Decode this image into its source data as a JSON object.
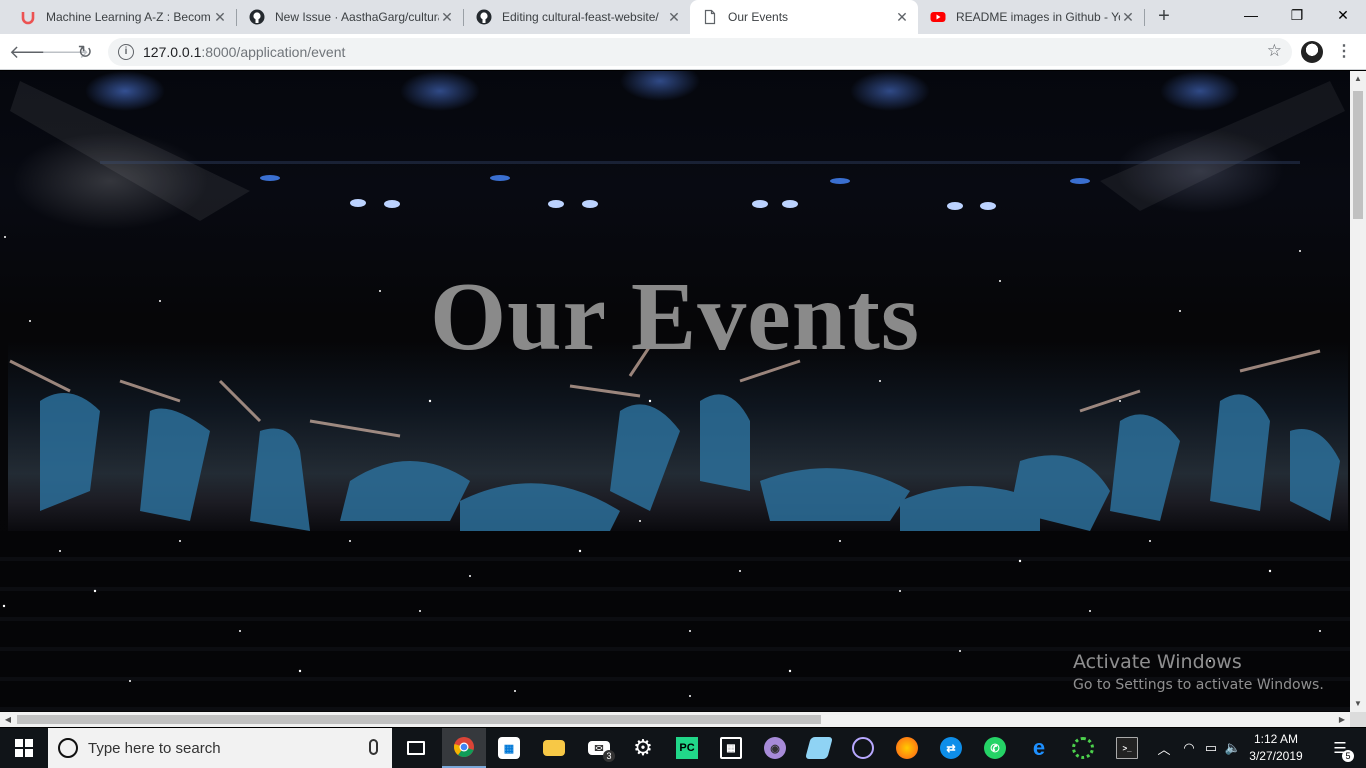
{
  "browser": {
    "tabs": [
      {
        "title": "Machine Learning A-Z : Becom",
        "icon": "udemy-icon",
        "active": false
      },
      {
        "title": "New Issue · AasthaGarg/cultura",
        "icon": "github-icon",
        "active": false
      },
      {
        "title": "Editing cultural-feast-website/",
        "icon": "github-icon",
        "active": false
      },
      {
        "title": "Our Events",
        "icon": "page-icon",
        "active": true
      },
      {
        "title": "README images in Github - Yo",
        "icon": "youtube-icon",
        "active": false
      }
    ],
    "url_host": "127.0.0.1",
    "url_path": ":8000/application/event"
  },
  "page": {
    "hero_title": "Our Events"
  },
  "watermark": {
    "line1": "Activate Windows",
    "line2": "Go to Settings to activate Windows."
  },
  "taskbar": {
    "search_placeholder": "Type here to search",
    "time": "1:12 AM",
    "date": "3/27/2019",
    "mail_badge": "3",
    "notification_count": "5"
  },
  "colors": {
    "hero_title": "#8a8a8a",
    "taskbar_bg": "#101418",
    "tabstrip_bg": "#dee1e6"
  }
}
